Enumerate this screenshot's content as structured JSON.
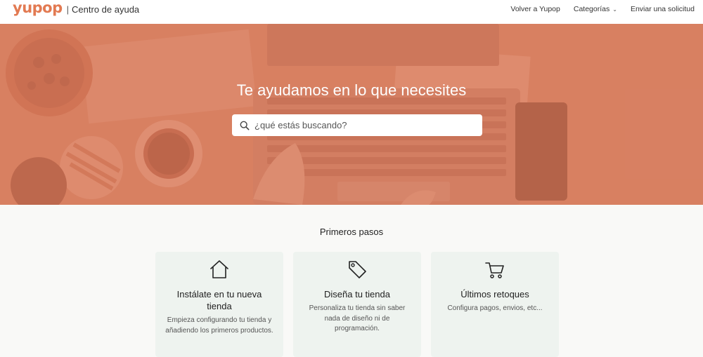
{
  "header": {
    "logo": "yupop",
    "brand_subtitle": "Centro de ayuda",
    "nav": {
      "back": "Volver a Yupop",
      "categories": "Categorías",
      "submit_request": "Enviar una solicitud"
    }
  },
  "hero": {
    "title": "Te ayudamos en lo que necesites",
    "search_placeholder": "¿qué estás buscando?"
  },
  "section": {
    "title": "Primeros pasos",
    "cards": [
      {
        "icon": "home-icon",
        "title": "Instálate en tu nueva tienda",
        "description": "Empieza configurando tu tienda y añadiendo los primeros productos."
      },
      {
        "icon": "tag-icon",
        "title": "Diseña tu tienda",
        "description": "Personaliza tu tienda sin saber nada de diseño ni de programación."
      },
      {
        "icon": "shopping-cart-icon",
        "title": "Últimos retoques",
        "description": "Configura pagos, envios, etc..."
      }
    ]
  },
  "colors": {
    "brand": "#e27a52",
    "hero_tint": "#d8856a",
    "card_bg": "#eef3ef"
  }
}
